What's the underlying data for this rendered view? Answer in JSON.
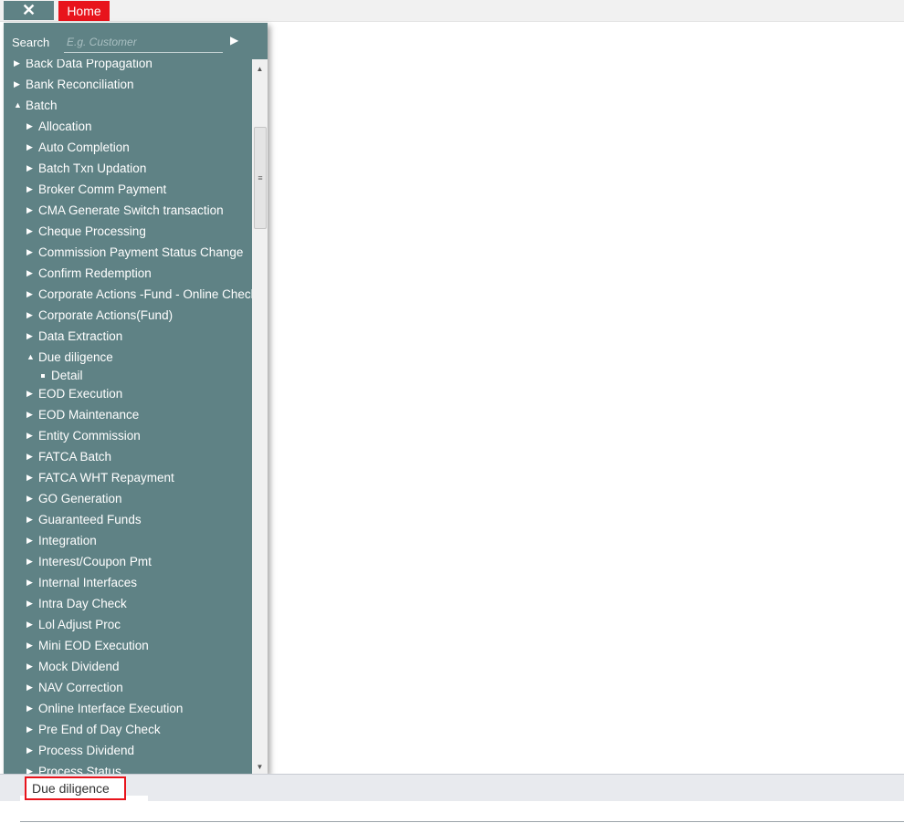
{
  "topbar": {
    "close_label": "✕",
    "home_tab_label": "Home"
  },
  "menu": {
    "search_label": "Search",
    "search_placeholder": "E.g. Customer",
    "search_go_icon": "play-icon",
    "items": [
      {
        "level": 0,
        "state": "collapsed",
        "label": "Back Data Propagation"
      },
      {
        "level": 0,
        "state": "collapsed",
        "label": "Bank Reconciliation"
      },
      {
        "level": 0,
        "state": "expanded",
        "label": "Batch"
      },
      {
        "level": 1,
        "state": "collapsed",
        "label": "Allocation"
      },
      {
        "level": 1,
        "state": "collapsed",
        "label": "Auto Completion"
      },
      {
        "level": 1,
        "state": "collapsed",
        "label": "Batch Txn Updation"
      },
      {
        "level": 1,
        "state": "collapsed",
        "label": "Broker Comm Payment"
      },
      {
        "level": 1,
        "state": "collapsed",
        "label": "CMA Generate Switch transaction"
      },
      {
        "level": 1,
        "state": "collapsed",
        "label": "Cheque Processing"
      },
      {
        "level": 1,
        "state": "collapsed",
        "label": "Commission Payment Status Change"
      },
      {
        "level": 1,
        "state": "collapsed",
        "label": "Confirm Redemption"
      },
      {
        "level": 1,
        "state": "collapsed",
        "label": "Corporate Actions -Fund - Online Check"
      },
      {
        "level": 1,
        "state": "collapsed",
        "label": "Corporate Actions(Fund)"
      },
      {
        "level": 1,
        "state": "collapsed",
        "label": "Data Extraction"
      },
      {
        "level": 1,
        "state": "expanded",
        "label": "Due diligence"
      },
      {
        "level": 2,
        "state": "leaf",
        "label": "Detail"
      },
      {
        "level": 1,
        "state": "collapsed",
        "label": "EOD Execution"
      },
      {
        "level": 1,
        "state": "collapsed",
        "label": "EOD Maintenance"
      },
      {
        "level": 1,
        "state": "collapsed",
        "label": "Entity Commission"
      },
      {
        "level": 1,
        "state": "collapsed",
        "label": "FATCA Batch"
      },
      {
        "level": 1,
        "state": "collapsed",
        "label": "FATCA WHT Repayment"
      },
      {
        "level": 1,
        "state": "collapsed",
        "label": "GO Generation"
      },
      {
        "level": 1,
        "state": "collapsed",
        "label": "Guaranteed Funds"
      },
      {
        "level": 1,
        "state": "collapsed",
        "label": "Integration"
      },
      {
        "level": 1,
        "state": "collapsed",
        "label": "Interest/Coupon Pmt"
      },
      {
        "level": 1,
        "state": "collapsed",
        "label": "Internal Interfaces"
      },
      {
        "level": 1,
        "state": "collapsed",
        "label": "Intra Day Check"
      },
      {
        "level": 1,
        "state": "collapsed",
        "label": "Lol Adjust Proc"
      },
      {
        "level": 1,
        "state": "collapsed",
        "label": "Mini EOD Execution"
      },
      {
        "level": 1,
        "state": "collapsed",
        "label": "Mock Dividend"
      },
      {
        "level": 1,
        "state": "collapsed",
        "label": "NAV Correction"
      },
      {
        "level": 1,
        "state": "collapsed",
        "label": "Online Interface Execution"
      },
      {
        "level": 1,
        "state": "collapsed",
        "label": "Pre End of Day Check"
      },
      {
        "level": 1,
        "state": "collapsed",
        "label": "Process Dividend"
      },
      {
        "level": 1,
        "state": "collapsed",
        "label": "Process Status"
      }
    ]
  },
  "taskbar": {
    "active_tab_label": "Due diligence"
  },
  "colors": {
    "panel": "#5f8285",
    "accent_red": "#e8141c"
  }
}
